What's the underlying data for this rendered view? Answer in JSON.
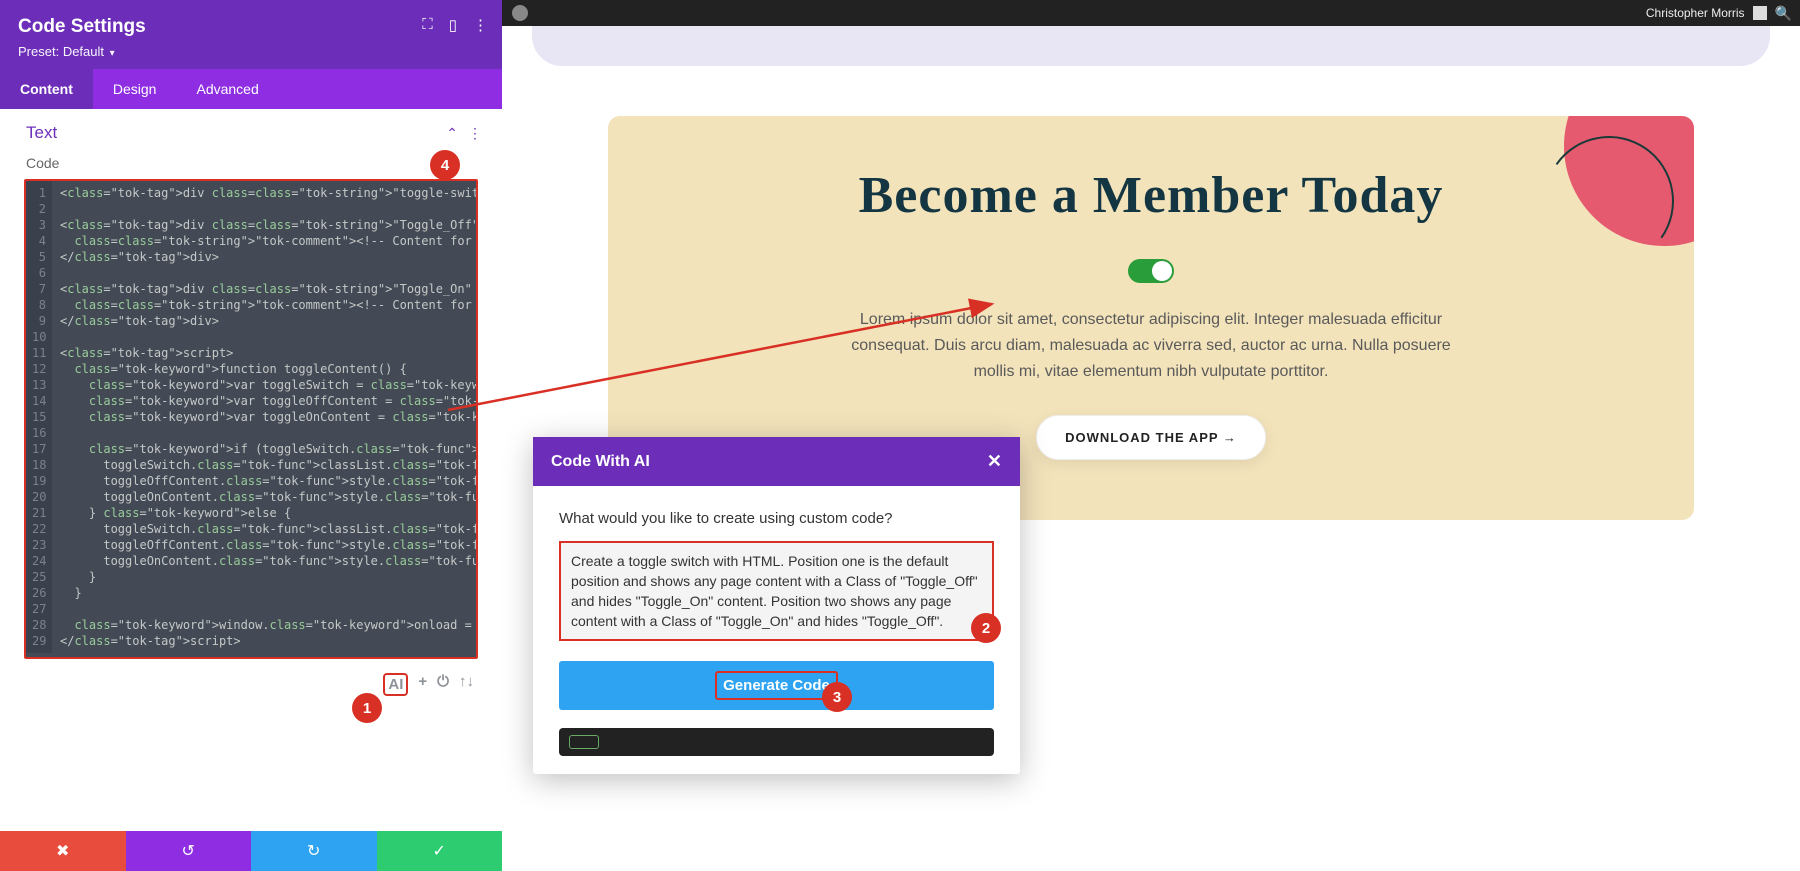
{
  "panel": {
    "title": "Code Settings",
    "preset_label": "Preset:",
    "preset_value": "Default",
    "tabs": {
      "content": "Content",
      "design": "Design",
      "advanced": "Advanced"
    },
    "section_title": "Text",
    "code_label": "Code",
    "toolbar": {
      "ai": "AI",
      "plus": "+",
      "power": "⏻",
      "arrows": "↑↓"
    },
    "bottom": {
      "cancel": "✖",
      "undo": "↺",
      "redo": "↻",
      "save": "✓"
    },
    "code_lines": [
      "<div class=\"toggle-switch on\" onclick=\"toggleContent()\"></div>",
      "",
      "<div class=\"Toggle_Off\">",
      "  <!-- Content for Toggle Off Position -->",
      "</div>",
      "",
      "<div class=\"Toggle_On\" style=\"display: none\">",
      "  <!-- Content for Toggle On Position -->",
      "</div>",
      "",
      "<script>",
      "  function toggleContent() {",
      "    var toggleSwitch = document.querySelector(\".toggle-switch\");",
      "    var toggleOffContent = document.getElementById(\"Toggle_Off\");",
      "    var toggleOnContent = document.getElementById(\"Toggle_On\");",
      "",
      "    if (toggleSwitch.classList.contains(\"on\")) {",
      "      toggleSwitch.classList.remove(\"on\");",
      "      toggleOffContent.style.display = \"none\";",
      "      toggleOnContent.style.display = \"block\";",
      "    } else {",
      "      toggleSwitch.classList.add(\"on\");",
      "      toggleOffContent.style.display = \"block\";",
      "      toggleOnContent.style.display = \"none\";",
      "    }",
      "  }",
      "",
      "  window.onload = toggleContent;",
      "</script>"
    ]
  },
  "admin": {
    "username": "Christopher Morris"
  },
  "hero": {
    "title": "Become a Member Today",
    "text": "Lorem ipsum dolor sit amet, consectetur adipiscing elit. Integer malesuada efficitur consequat. Duis arcu diam, malesuada ac viverra sed, auctor ac urna. Nulla posuere mollis mi, vitae elementum nibh vulputate porttitor.",
    "cta": "DOWNLOAD THE APP →"
  },
  "ai_modal": {
    "title": "Code With AI",
    "close": "✕",
    "prompt_label": "What would you like to create using custom code?",
    "prompt_value": "Create a toggle switch with HTML. Position one is the default position and shows any page content with a Class of \"Toggle_Off\" and hides \"Toggle_On\" content. Position two shows any page content with a Class of \"Toggle_On\" and hides \"Toggle_Off\".",
    "generate": "Generate Code"
  },
  "badges": {
    "b1": "1",
    "b2": "2",
    "b3": "3",
    "b4": "4"
  },
  "colors": {
    "accent": "#d93025",
    "purple": "#6c2eb9",
    "purple2": "#8e2de2",
    "blue": "#2ea3f2",
    "green": "#2ecc71"
  }
}
